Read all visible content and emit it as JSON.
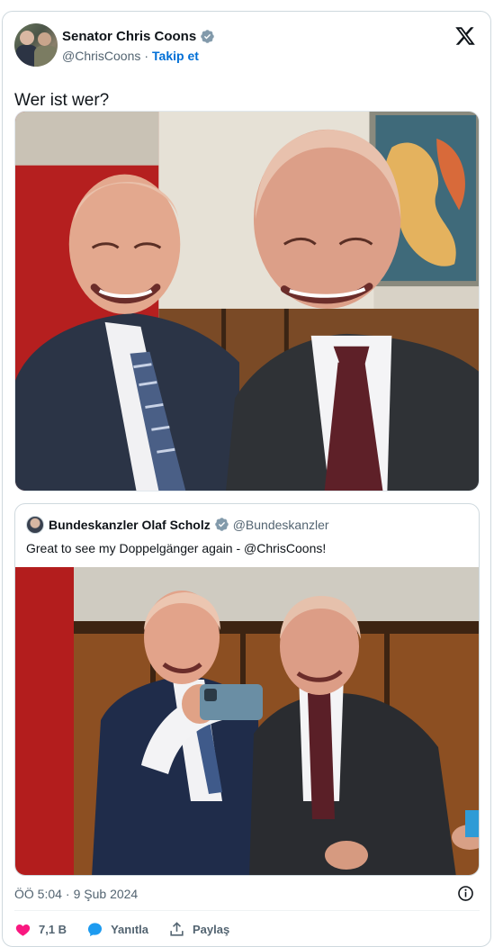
{
  "tweet": {
    "author_name": "Senator Chris Coons",
    "author_handle": "@ChrisCoons",
    "separator": "·",
    "follow_label": "Takip et",
    "text": "Wer ist wer?",
    "photo_alt": "Chris Coons and Olaf Scholz smiling selfie"
  },
  "quote": {
    "author_name": "Bundeskanzler Olaf Scholz",
    "author_handle": "@Bundeskanzler",
    "text": "Great to see my Doppelgänger again - @ChrisCoons!",
    "photo_alt": "Chris Coons taking a selfie with Olaf Scholz"
  },
  "footer": {
    "time": "ÖÖ 5:04",
    "separator": "·",
    "date": "9 Şub 2024",
    "like_count": "7,1 B",
    "reply_label": "Yanıtla",
    "share_label": "Paylaş"
  },
  "colors": {
    "accent": "#006fd6",
    "verified": "#829aab",
    "like": "#f91880",
    "reply": "#1d9bf0",
    "text_secondary": "#536471"
  },
  "icons": [
    "x-logo-icon",
    "verified-badge-icon",
    "info-icon",
    "heart-icon",
    "reply-icon",
    "share-icon"
  ]
}
